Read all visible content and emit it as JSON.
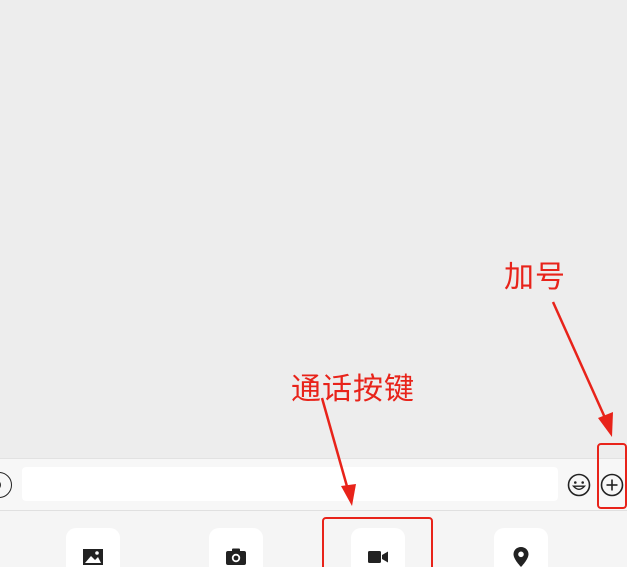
{
  "annotations": {
    "call_button_label": "通话按键",
    "plus_label": "加号"
  },
  "input_bar": {
    "text_value": "",
    "icons": [
      "voice-icon",
      "emoji-icon",
      "plus-circle-icon"
    ]
  },
  "panel": {
    "tiles": [
      {
        "icon": "image-icon"
      },
      {
        "icon": "camera-icon"
      },
      {
        "icon": "video-call-icon"
      },
      {
        "icon": "location-pin-icon"
      }
    ]
  },
  "colors": {
    "annotation_red": "#e8231a",
    "chat_bg": "#ededed",
    "panel_bg": "#f5f5f5",
    "icon_dark": "#222222"
  }
}
